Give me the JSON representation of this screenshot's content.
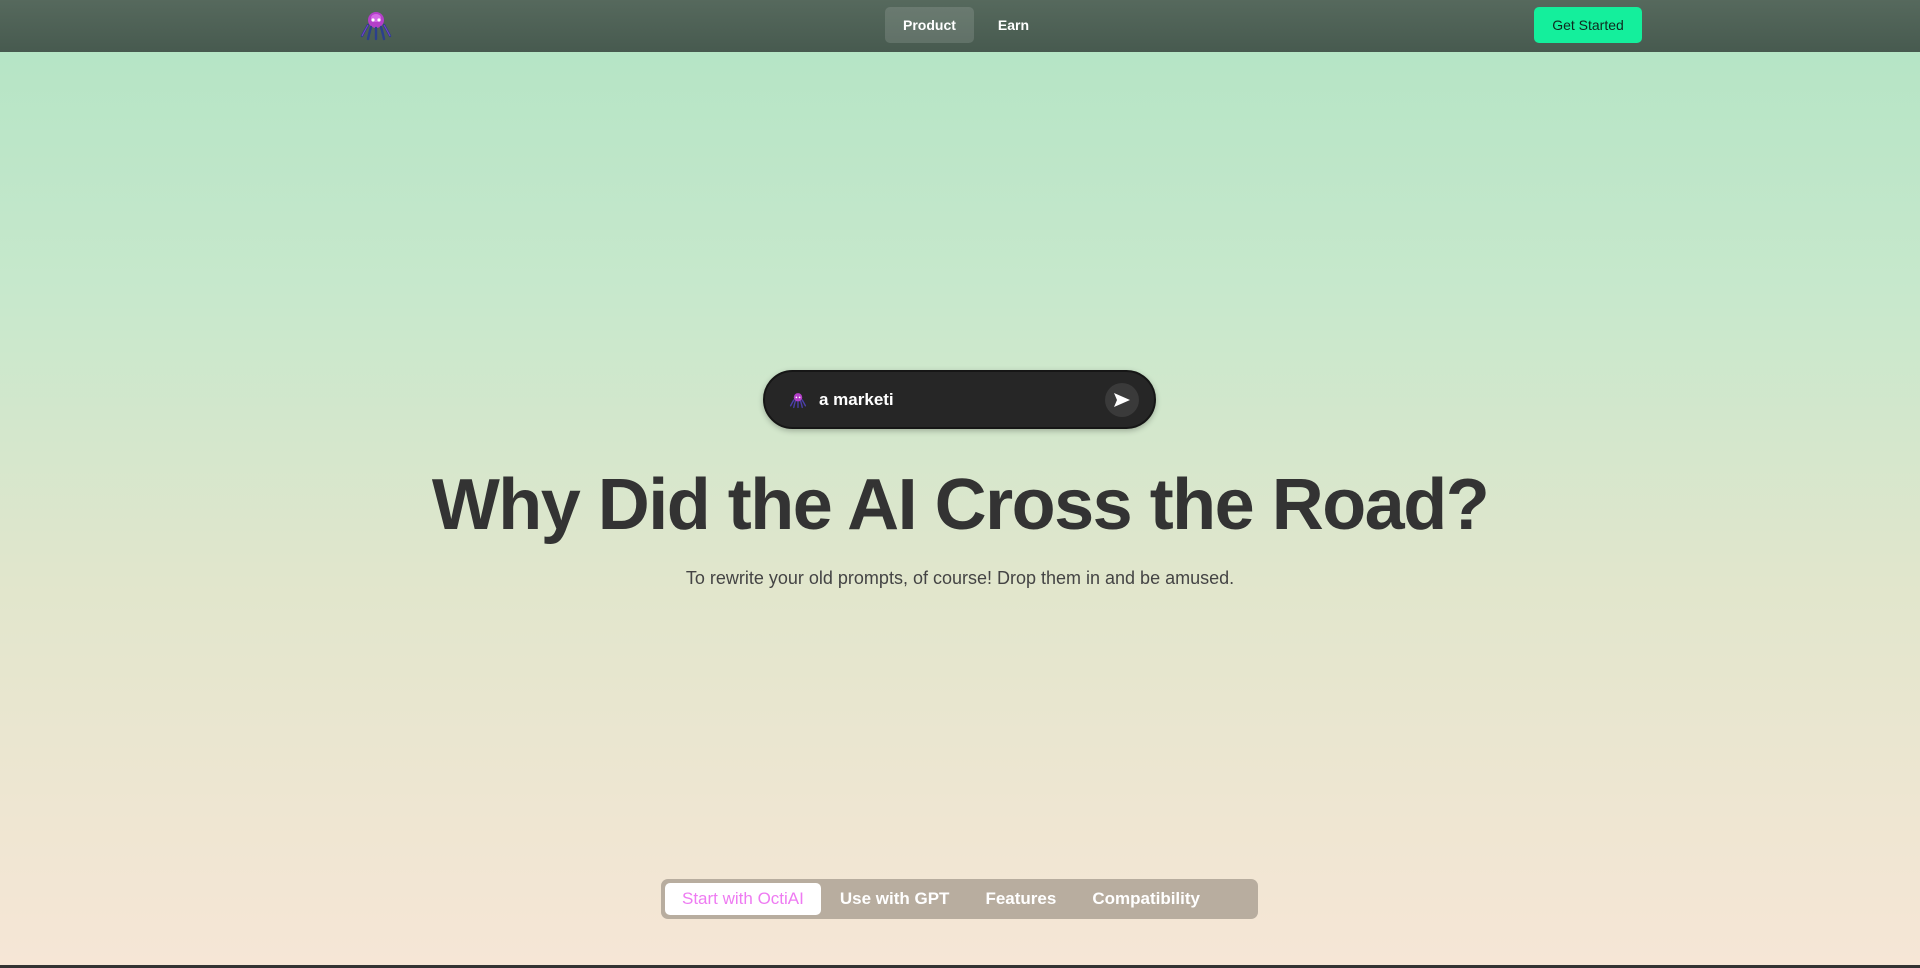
{
  "nav": {
    "logo_icon": "octopus-logo-icon",
    "items": [
      {
        "label": "Product",
        "active": true
      },
      {
        "label": "Earn",
        "active": false
      }
    ],
    "cta_label": "Get Started"
  },
  "prompt": {
    "value": "a marketi",
    "logo_icon": "octopus-logo-icon",
    "send_icon": "send-arrow-icon"
  },
  "hero": {
    "title": "Why Did the AI Cross the Road?",
    "subtitle": "To rewrite your old prompts, of course! Drop them in and be amused."
  },
  "tabs": [
    {
      "label": "Start with OctiAI",
      "active": true
    },
    {
      "label": "Use with GPT",
      "active": false
    },
    {
      "label": "Features",
      "active": false
    },
    {
      "label": "Compatibility",
      "active": false
    }
  ],
  "colors": {
    "accent": "#14ef9c",
    "nav_bg": "#4e6156",
    "active_tab_text": "#ee7bf2",
    "prompt_bg": "#262626"
  }
}
